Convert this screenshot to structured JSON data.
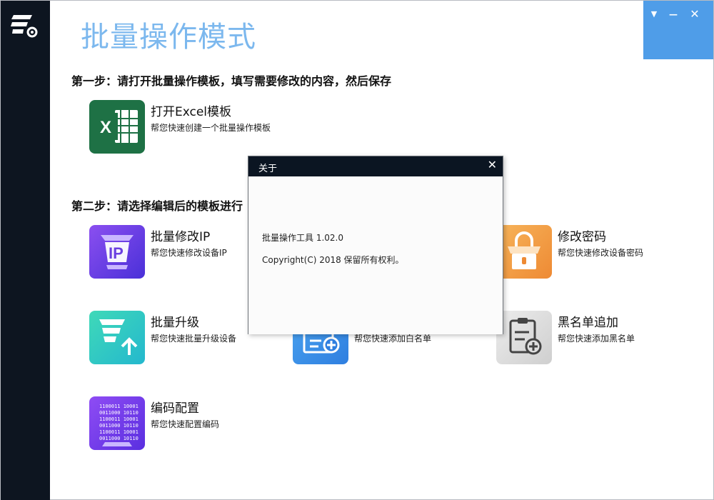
{
  "header": {
    "title": "批量操作模式"
  },
  "window_controls": {
    "dropdown": "▼",
    "minimize": "—",
    "close": "✕"
  },
  "steps": {
    "step1": "第一步：请打开批量操作模板，填写需要修改的内容，然后保存",
    "step2": "第二步：请选择编辑后的模板进行"
  },
  "cards": {
    "excel": {
      "name": "打开Excel模板",
      "desc": "帮您快速创建一个批量操作模板",
      "color": "#1e7145"
    },
    "ip": {
      "name": "批量修改IP",
      "desc": "帮您快速修改设备IP",
      "color": "#6b3fe0"
    },
    "password": {
      "name": "修改密码",
      "desc": "帮您快速修改设备密码",
      "color": "#f0943a"
    },
    "upgrade": {
      "name": "批量升级",
      "desc": "帮您快速批量升级设备",
      "color": "#2ec9b0"
    },
    "whitelist": {
      "desc": "帮您快速添加白名单",
      "color": "#3e8fe5"
    },
    "blacklist": {
      "name": "黑名单追加",
      "desc": "帮您快速添加黑名单",
      "color": "#d6d6d6"
    },
    "encoding": {
      "name": "编码配置",
      "desc": "帮您快速配置编码",
      "color": "#7a3ff0"
    }
  },
  "about_dialog": {
    "title": "关于",
    "close": "✕",
    "product": "批量操作工具 1.02.0",
    "copyright": "Copyright(C) 2018 保留所有权利。"
  }
}
